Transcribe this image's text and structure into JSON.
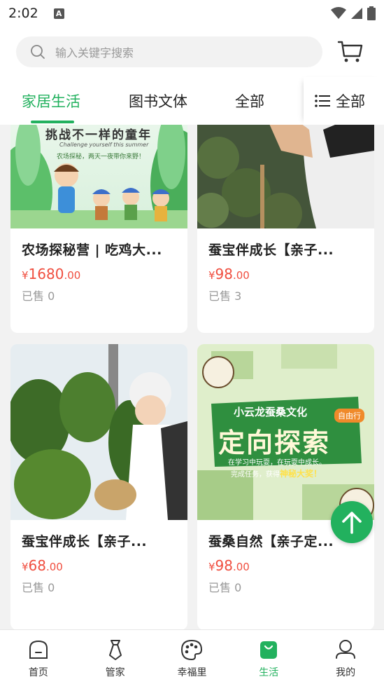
{
  "status_bar": {
    "time": "2:02",
    "notification_glyph": "A"
  },
  "search": {
    "placeholder": "输入关键字搜索"
  },
  "tabs": [
    {
      "label": "家居生活",
      "active": true
    },
    {
      "label": "图书文体",
      "active": false
    },
    {
      "label": "全部",
      "active": false
    }
  ],
  "tab_menu": {
    "label": "全部"
  },
  "products": [
    {
      "title": "农场探秘营 | 吃鸡大...",
      "currency": "¥",
      "price_int": "1680",
      "price_dec": ".00",
      "sold": "已售 0",
      "poster_text": "挑战不一样的童年",
      "poster_en": "Challenge yourself this summer",
      "poster_sub": "农场探秘，两天一夜带你来野！"
    },
    {
      "title": "蚕宝伴成长【亲子...",
      "currency": "¥",
      "price_int": "98",
      "price_dec": ".00",
      "sold": "已售 3"
    },
    {
      "title": "蚕宝伴成长【亲子...",
      "currency": "¥",
      "price_int": "68",
      "price_dec": ".00",
      "sold": "已售 0"
    },
    {
      "title": "蚕桑自然【亲子定...",
      "currency": "¥",
      "price_int": "98",
      "price_dec": ".00",
      "sold": "已售 0",
      "poster_line1": "小云龙蚕桑文化",
      "poster_badge": "自由行",
      "poster_main": "定向探索",
      "poster_sub1": "在学习中玩耍，在玩耍中成长。",
      "poster_sub2": "完成任务，获得",
      "poster_sub3": "神秘大奖！"
    }
  ],
  "bottom_nav": [
    {
      "label": "首页",
      "icon": "home-icon",
      "active": false
    },
    {
      "label": "管家",
      "icon": "butler-tie-icon",
      "active": false
    },
    {
      "label": "幸福里",
      "icon": "palette-icon",
      "active": false
    },
    {
      "label": "生活",
      "icon": "shopping-bag-icon",
      "active": true
    },
    {
      "label": "我的",
      "icon": "profile-icon",
      "active": false
    }
  ],
  "colors": {
    "accent": "#22b15e",
    "price": "#f04e3f"
  }
}
